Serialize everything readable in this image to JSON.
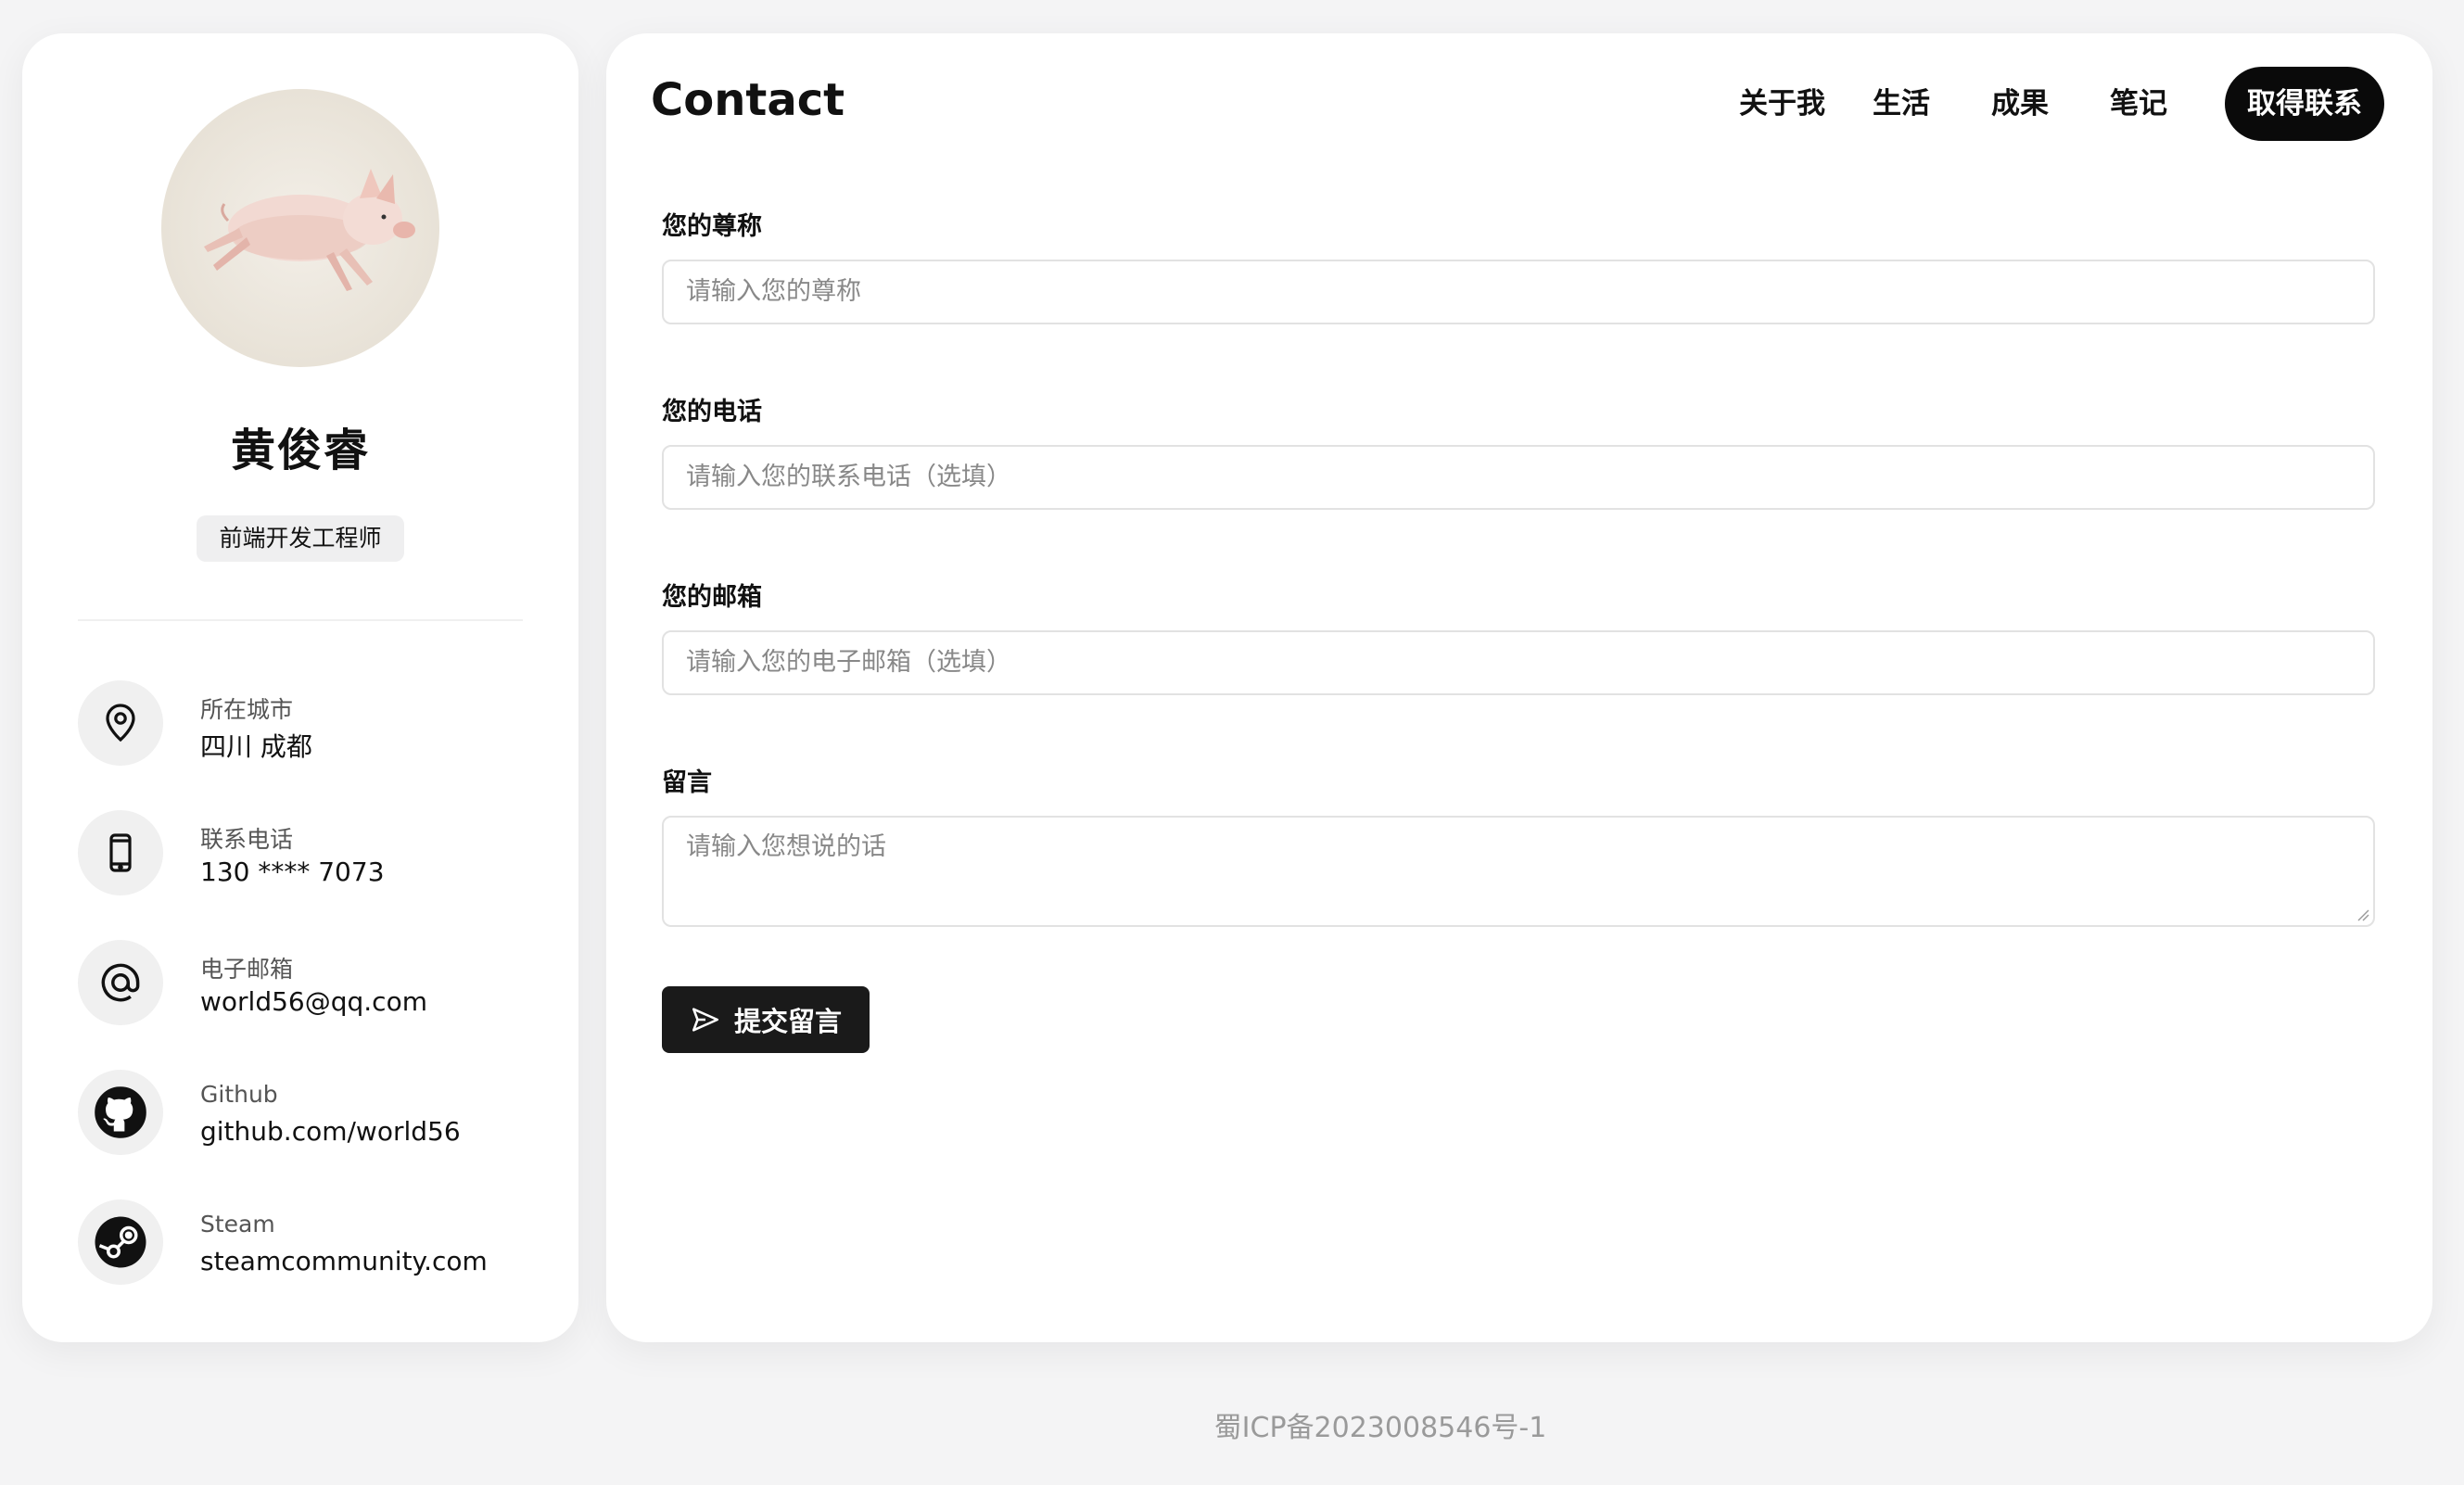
{
  "profile": {
    "name": "黄俊睿",
    "role": "前端开发工程师",
    "info": [
      {
        "icon": "location-pin-icon",
        "label": "所在城市",
        "value": "四川 成都"
      },
      {
        "icon": "phone-icon",
        "label": "联系电话",
        "value": "130 **** 7073"
      },
      {
        "icon": "at-sign-icon",
        "label": "电子邮箱",
        "value": "world56@qq.com"
      },
      {
        "icon": "github-icon",
        "label": "Github",
        "value": "github.com/world56"
      },
      {
        "icon": "steam-icon",
        "label": "Steam",
        "value": "steamcommunity.com"
      }
    ]
  },
  "header": {
    "title": "Contact",
    "nav": [
      "关于我",
      "生活",
      "成果",
      "笔记",
      "取得联系"
    ],
    "active_nav": "取得联系"
  },
  "form": {
    "nickname": {
      "label": "您的尊称",
      "placeholder": "请输入您的尊称"
    },
    "phone": {
      "label": "您的电话",
      "placeholder": "请输入您的联系电话（选填）"
    },
    "email": {
      "label": "您的邮箱",
      "placeholder": "请输入您的电子邮箱（选填）"
    },
    "message": {
      "label": "留言",
      "placeholder": "请输入您想说的话"
    },
    "submit_label": "提交留言"
  },
  "footer": {
    "icp": "蜀ICP备2023008546号-1"
  },
  "colors": {
    "accent": "#0a0a0a",
    "background": "#f4f4f5",
    "card": "#ffffff"
  }
}
